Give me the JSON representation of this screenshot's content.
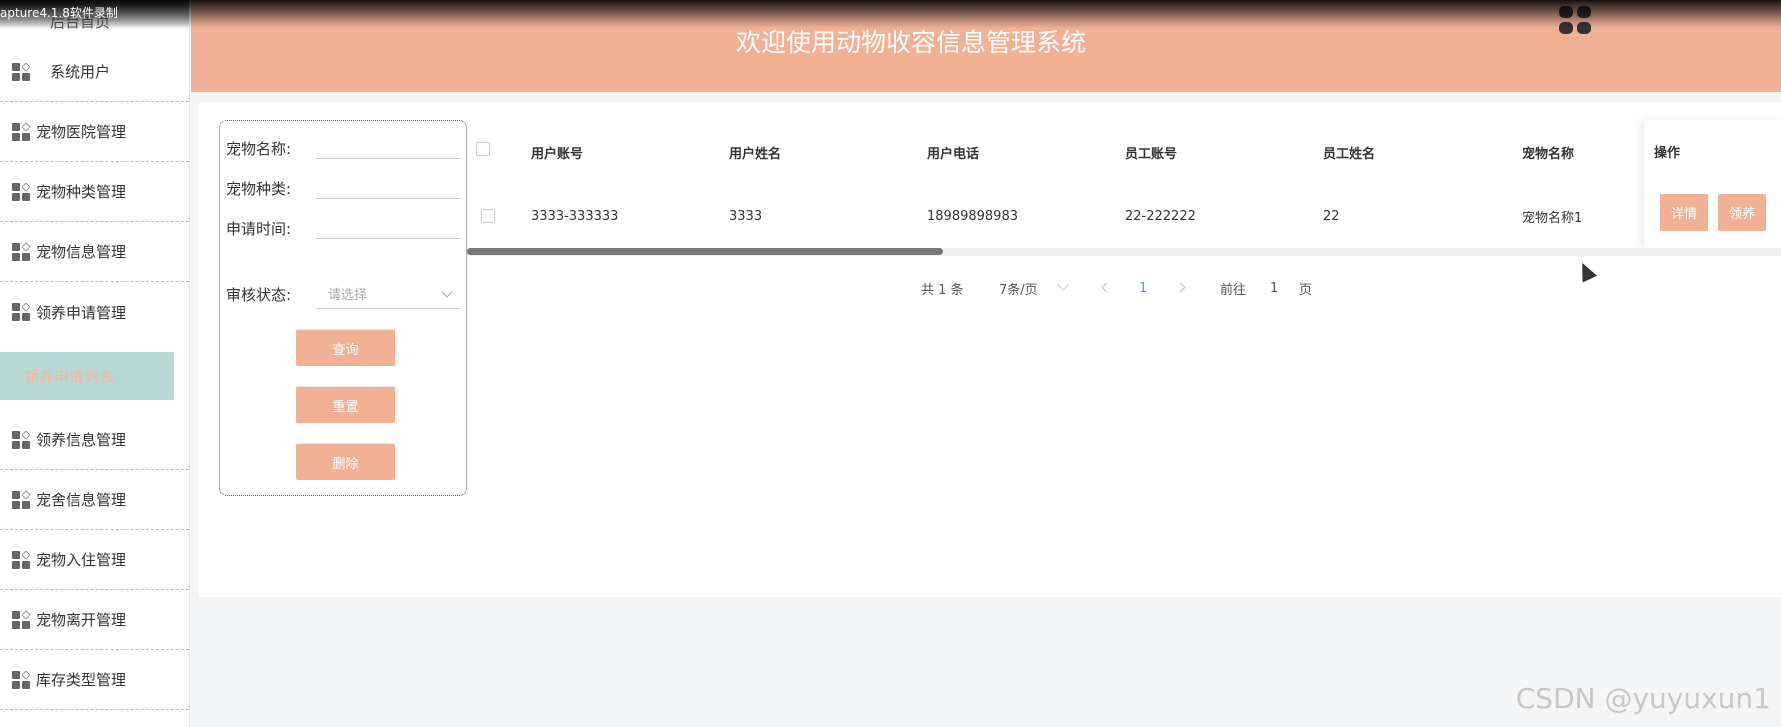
{
  "capture_overlay": "apture4.1.8软件录制",
  "header": {
    "title": "欢迎使用动物收容信息管理系统",
    "menu_icon": "grid-icon"
  },
  "sidebar": {
    "top_label": "后台首页",
    "items": [
      {
        "label": "系统用户"
      },
      {
        "label": "宠物医院管理"
      },
      {
        "label": "宠物种类管理"
      },
      {
        "label": "宠物信息管理"
      },
      {
        "label": "领养申请管理"
      }
    ],
    "active_sub": "领养申请列表",
    "items_after": [
      {
        "label": "领养信息管理"
      },
      {
        "label": "宠舍信息管理"
      },
      {
        "label": "宠物入住管理"
      },
      {
        "label": "宠物离开管理"
      },
      {
        "label": "库存类型管理"
      }
    ]
  },
  "search": {
    "pet_name_label": "宠物名称:",
    "pet_type_label": "宠物种类:",
    "apply_time_label": "申请时间:",
    "status_label": "审核状态:",
    "status_placeholder": "请选择",
    "query_button": "查询",
    "reset_button": "重置",
    "delete_button": "删除"
  },
  "table": {
    "columns": [
      "用户账号",
      "用户姓名",
      "用户电话",
      "员工账号",
      "员工姓名",
      "宠物名称"
    ],
    "ops_header": "操作",
    "rows": [
      {
        "cells": [
          "3333-333333",
          "3333",
          "18989898983",
          "22-222222",
          "22",
          "宠物名称1"
        ]
      }
    ],
    "detail_button": "详情",
    "adopt_button": "领养"
  },
  "pagination": {
    "total": "共 1 条",
    "page_size": "7条/页",
    "current_page": "1",
    "goto_label": "前往",
    "goto_value": "1",
    "page_suffix": "页"
  },
  "watermark": "CSDN @yuyuxun1"
}
